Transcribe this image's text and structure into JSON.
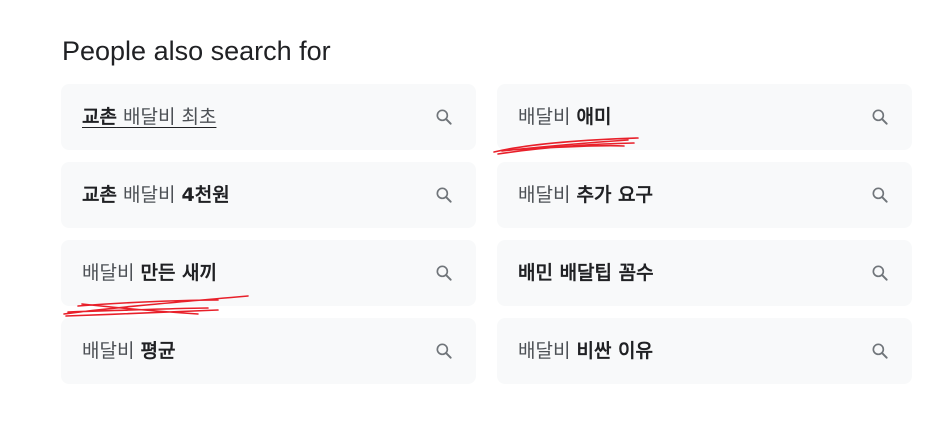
{
  "heading": "People also search for",
  "suggestions": [
    {
      "plain_before": "",
      "bold": "교촌",
      "plain_after": " 배달비 최초",
      "underlined": true,
      "icon": "search-icon"
    },
    {
      "plain_before": "배달비 ",
      "bold": "애미",
      "plain_after": "",
      "underlined": false,
      "icon": "search-icon"
    },
    {
      "plain_before": "",
      "bold": "교촌",
      "plain_after": " 배달비 ",
      "bold_after": "4천원",
      "underlined": false,
      "icon": "search-icon"
    },
    {
      "plain_before": "배달비 ",
      "bold": "추가 요구",
      "plain_after": "",
      "underlined": false,
      "icon": "search-icon"
    },
    {
      "plain_before": "배달비 ",
      "bold": "만든 새끼",
      "plain_after": "",
      "underlined": false,
      "icon": "search-icon"
    },
    {
      "plain_before": "",
      "bold": "배민 배달팁 꼼수",
      "plain_after": "",
      "underlined": false,
      "icon": "search-icon"
    },
    {
      "plain_before": "배달비 ",
      "bold": "평균",
      "plain_after": "",
      "underlined": false,
      "icon": "search-icon"
    },
    {
      "plain_before": "배달비 ",
      "bold": "비싼 이유",
      "plain_after": "",
      "underlined": false,
      "icon": "search-icon"
    }
  ],
  "colors": {
    "chip_background": "#f8f9fa",
    "text_plain": "#4d5156",
    "text_bold": "#202124",
    "icon": "#70757a",
    "scribble": "#e8202a"
  }
}
